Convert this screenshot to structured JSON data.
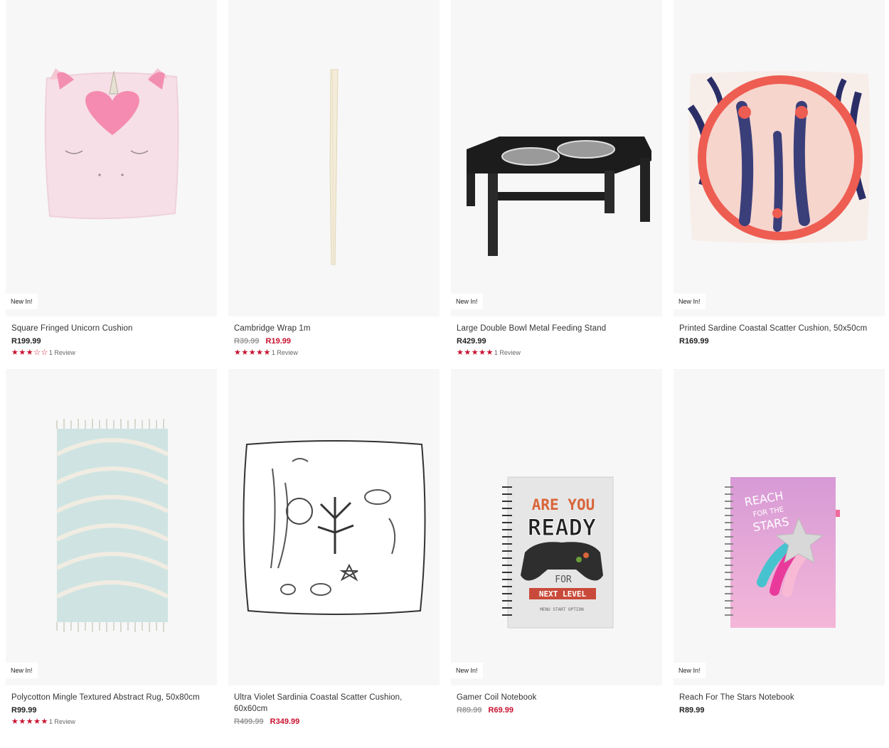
{
  "products": [
    {
      "name": "Square Fringed Unicorn Cushion",
      "badge": "New In!",
      "price": "R199.99",
      "stars": [
        1,
        1,
        1,
        0,
        0
      ],
      "reviews": "1 Review"
    },
    {
      "name": "Cambridge Wrap 1m",
      "badge": "",
      "was": "R39.99",
      "now": "R19.99",
      "stars": [
        1,
        1,
        1,
        1,
        1
      ],
      "reviews": "1 Review"
    },
    {
      "name": "Large Double Bowl Metal Feeding Stand",
      "badge": "New In!",
      "price": "R429.99",
      "stars": [
        1,
        1,
        1,
        1,
        1
      ],
      "reviews": "1 Review"
    },
    {
      "name": "Printed Sardine Coastal Scatter Cushion, 50x50cm",
      "badge": "New In!",
      "price": "R169.99"
    },
    {
      "name": "Polycotton Mingle Textured Abstract Rug, 50x80cm",
      "badge": "New In!",
      "price": "R99.99",
      "stars": [
        1,
        1,
        1,
        1,
        1
      ],
      "reviews": "1 Review"
    },
    {
      "name": "Ultra Violet Sardinia Coastal Scatter Cushion, 60x60cm",
      "badge": "",
      "was": "R499.99",
      "now": "R349.99"
    },
    {
      "name": "Gamer Coil Notebook",
      "badge": "New In!",
      "was": "R89.99",
      "now": "R69.99",
      "notebook": {
        "line1": "ARE YOU",
        "line2": "READY",
        "line3": "FOR",
        "line4": "NEXT LEVEL",
        "line5": "MENU START OPTION"
      }
    },
    {
      "name": "Reach For The Stars Notebook",
      "badge": "New In!",
      "price": "R89.99",
      "notebook": {
        "line1": "REACH",
        "line2": "FOR THE",
        "line3": "STARS"
      }
    }
  ],
  "icons": {
    "star": "star-icon",
    "star_empty": "star-outline-icon"
  },
  "colors": {
    "sale": "#c8102e",
    "was": "#9a9a9a",
    "card_bg": "#f7f7f7"
  }
}
